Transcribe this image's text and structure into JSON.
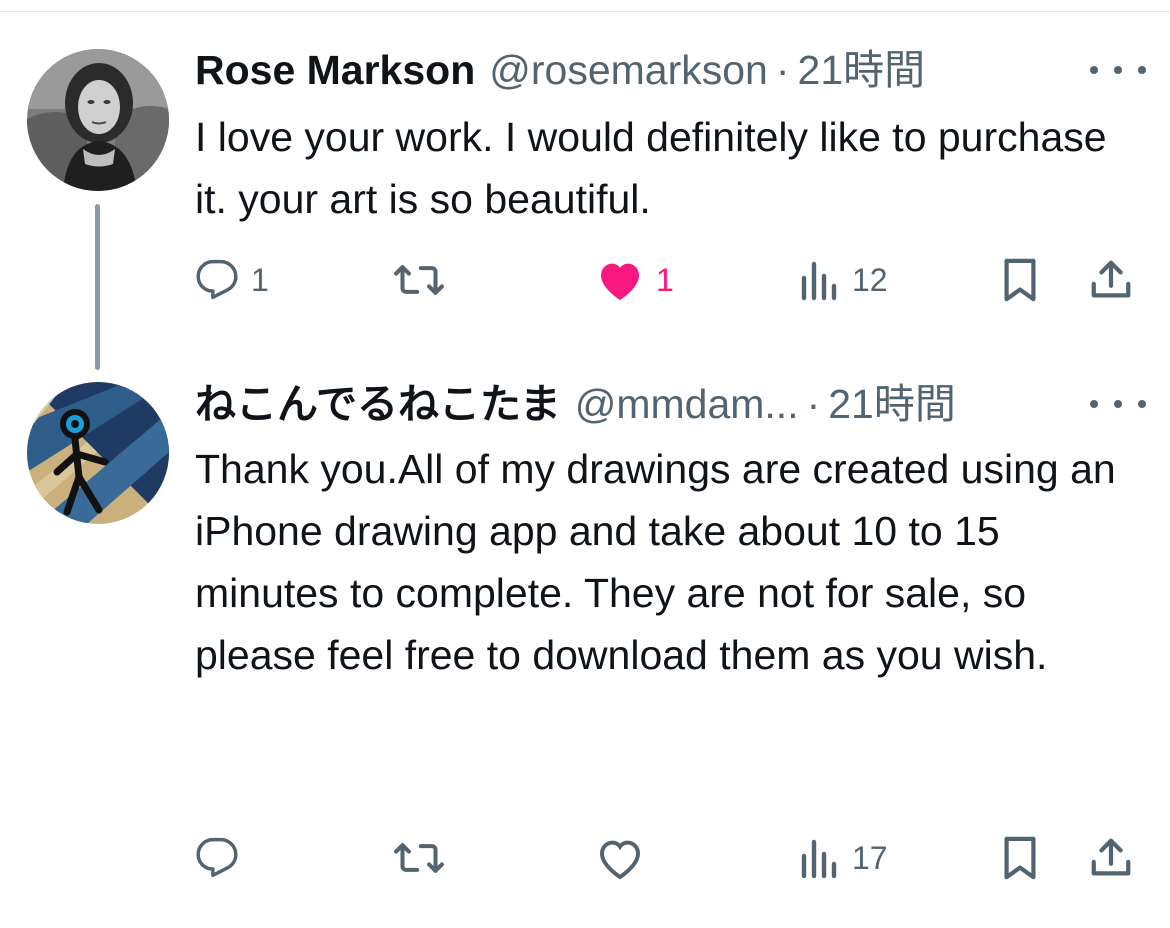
{
  "tweets": [
    {
      "name": "Rose Markson",
      "handle": "@rosemarkson",
      "separator": "·",
      "time": "21時間",
      "text": "I love your work. I would definitely like to purchase it. your art is so beautiful.",
      "replies": "1",
      "retweets": "",
      "likes": "1",
      "views": "12",
      "liked": true
    },
    {
      "name": "ねこんでるねこたま",
      "handle": "@mmdam...",
      "separator": "·",
      "time": "21時間",
      "text": "Thank you.All of my drawings are created using an iPhone drawing app and take about 10 to 15 minutes to complete. They are not for sale, so please feel free to download them as you wish.",
      "replies": "",
      "retweets": "",
      "likes": "",
      "views": "17",
      "liked": false
    }
  ],
  "colors": {
    "text": "#0f1419",
    "secondary": "#536471",
    "like_active": "#f91880",
    "thread_line": "#8b98a5"
  },
  "icons": [
    "reply-icon",
    "retweet-icon",
    "like-icon",
    "views-icon",
    "bookmark-icon",
    "share-icon",
    "more-icon"
  ]
}
